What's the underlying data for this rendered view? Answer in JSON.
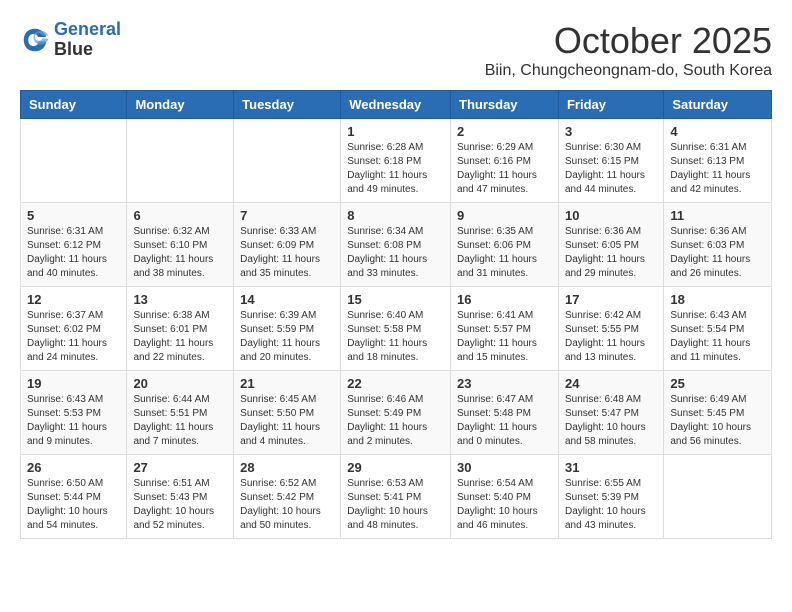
{
  "header": {
    "logo_line1": "General",
    "logo_line2": "Blue",
    "month": "October 2025",
    "location": "Biin, Chungcheongnam-do, South Korea"
  },
  "weekdays": [
    "Sunday",
    "Monday",
    "Tuesday",
    "Wednesday",
    "Thursday",
    "Friday",
    "Saturday"
  ],
  "weeks": [
    [
      {
        "day": "",
        "info": ""
      },
      {
        "day": "",
        "info": ""
      },
      {
        "day": "",
        "info": ""
      },
      {
        "day": "1",
        "info": "Sunrise: 6:28 AM\nSunset: 6:18 PM\nDaylight: 11 hours\nand 49 minutes."
      },
      {
        "day": "2",
        "info": "Sunrise: 6:29 AM\nSunset: 6:16 PM\nDaylight: 11 hours\nand 47 minutes."
      },
      {
        "day": "3",
        "info": "Sunrise: 6:30 AM\nSunset: 6:15 PM\nDaylight: 11 hours\nand 44 minutes."
      },
      {
        "day": "4",
        "info": "Sunrise: 6:31 AM\nSunset: 6:13 PM\nDaylight: 11 hours\nand 42 minutes."
      }
    ],
    [
      {
        "day": "5",
        "info": "Sunrise: 6:31 AM\nSunset: 6:12 PM\nDaylight: 11 hours\nand 40 minutes."
      },
      {
        "day": "6",
        "info": "Sunrise: 6:32 AM\nSunset: 6:10 PM\nDaylight: 11 hours\nand 38 minutes."
      },
      {
        "day": "7",
        "info": "Sunrise: 6:33 AM\nSunset: 6:09 PM\nDaylight: 11 hours\nand 35 minutes."
      },
      {
        "day": "8",
        "info": "Sunrise: 6:34 AM\nSunset: 6:08 PM\nDaylight: 11 hours\nand 33 minutes."
      },
      {
        "day": "9",
        "info": "Sunrise: 6:35 AM\nSunset: 6:06 PM\nDaylight: 11 hours\nand 31 minutes."
      },
      {
        "day": "10",
        "info": "Sunrise: 6:36 AM\nSunset: 6:05 PM\nDaylight: 11 hours\nand 29 minutes."
      },
      {
        "day": "11",
        "info": "Sunrise: 6:36 AM\nSunset: 6:03 PM\nDaylight: 11 hours\nand 26 minutes."
      }
    ],
    [
      {
        "day": "12",
        "info": "Sunrise: 6:37 AM\nSunset: 6:02 PM\nDaylight: 11 hours\nand 24 minutes."
      },
      {
        "day": "13",
        "info": "Sunrise: 6:38 AM\nSunset: 6:01 PM\nDaylight: 11 hours\nand 22 minutes."
      },
      {
        "day": "14",
        "info": "Sunrise: 6:39 AM\nSunset: 5:59 PM\nDaylight: 11 hours\nand 20 minutes."
      },
      {
        "day": "15",
        "info": "Sunrise: 6:40 AM\nSunset: 5:58 PM\nDaylight: 11 hours\nand 18 minutes."
      },
      {
        "day": "16",
        "info": "Sunrise: 6:41 AM\nSunset: 5:57 PM\nDaylight: 11 hours\nand 15 minutes."
      },
      {
        "day": "17",
        "info": "Sunrise: 6:42 AM\nSunset: 5:55 PM\nDaylight: 11 hours\nand 13 minutes."
      },
      {
        "day": "18",
        "info": "Sunrise: 6:43 AM\nSunset: 5:54 PM\nDaylight: 11 hours\nand 11 minutes."
      }
    ],
    [
      {
        "day": "19",
        "info": "Sunrise: 6:43 AM\nSunset: 5:53 PM\nDaylight: 11 hours\nand 9 minutes."
      },
      {
        "day": "20",
        "info": "Sunrise: 6:44 AM\nSunset: 5:51 PM\nDaylight: 11 hours\nand 7 minutes."
      },
      {
        "day": "21",
        "info": "Sunrise: 6:45 AM\nSunset: 5:50 PM\nDaylight: 11 hours\nand 4 minutes."
      },
      {
        "day": "22",
        "info": "Sunrise: 6:46 AM\nSunset: 5:49 PM\nDaylight: 11 hours\nand 2 minutes."
      },
      {
        "day": "23",
        "info": "Sunrise: 6:47 AM\nSunset: 5:48 PM\nDaylight: 11 hours\nand 0 minutes."
      },
      {
        "day": "24",
        "info": "Sunrise: 6:48 AM\nSunset: 5:47 PM\nDaylight: 10 hours\nand 58 minutes."
      },
      {
        "day": "25",
        "info": "Sunrise: 6:49 AM\nSunset: 5:45 PM\nDaylight: 10 hours\nand 56 minutes."
      }
    ],
    [
      {
        "day": "26",
        "info": "Sunrise: 6:50 AM\nSunset: 5:44 PM\nDaylight: 10 hours\nand 54 minutes."
      },
      {
        "day": "27",
        "info": "Sunrise: 6:51 AM\nSunset: 5:43 PM\nDaylight: 10 hours\nand 52 minutes."
      },
      {
        "day": "28",
        "info": "Sunrise: 6:52 AM\nSunset: 5:42 PM\nDaylight: 10 hours\nand 50 minutes."
      },
      {
        "day": "29",
        "info": "Sunrise: 6:53 AM\nSunset: 5:41 PM\nDaylight: 10 hours\nand 48 minutes."
      },
      {
        "day": "30",
        "info": "Sunrise: 6:54 AM\nSunset: 5:40 PM\nDaylight: 10 hours\nand 46 minutes."
      },
      {
        "day": "31",
        "info": "Sunrise: 6:55 AM\nSunset: 5:39 PM\nDaylight: 10 hours\nand 43 minutes."
      },
      {
        "day": "",
        "info": ""
      }
    ]
  ]
}
